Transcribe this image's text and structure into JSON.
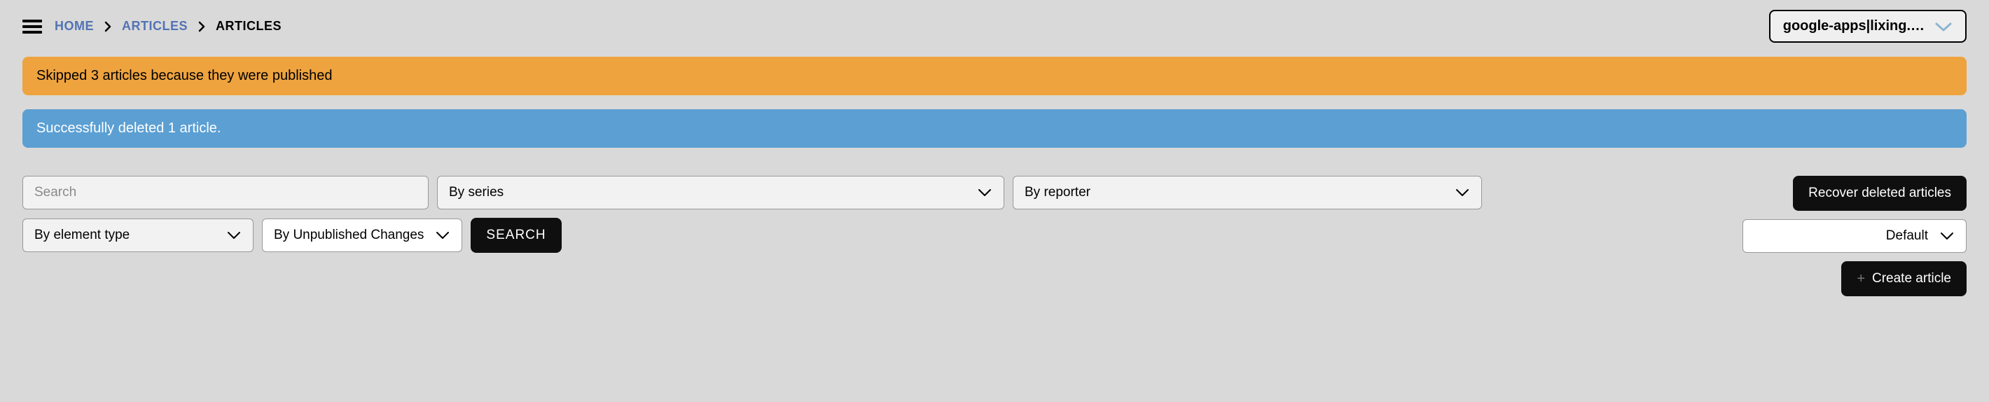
{
  "breadcrumb": {
    "home": "HOME",
    "articles_link": "ARTICLES",
    "current": "ARTICLES"
  },
  "user": {
    "label": "google-apps|lixing.…"
  },
  "alerts": {
    "warning": "Skipped 3 articles because they were published",
    "info": "Successfully deleted 1 article."
  },
  "filters": {
    "search_placeholder": "Search",
    "by_series": "By series",
    "by_reporter": "By reporter",
    "by_element_type": "By element type",
    "by_unpublished": "By Unpublished Changes",
    "search_button": "SEARCH"
  },
  "actions": {
    "recover": "Recover deleted articles",
    "default_sort": "Default",
    "create": "Create article"
  },
  "colors": {
    "alert_warning_bg": "#eea33e",
    "alert_info_bg": "#5b9fd3",
    "link": "#5373b4",
    "btn_dark_bg": "#0f0f0f",
    "user_chevron": "#8fb6cf"
  }
}
